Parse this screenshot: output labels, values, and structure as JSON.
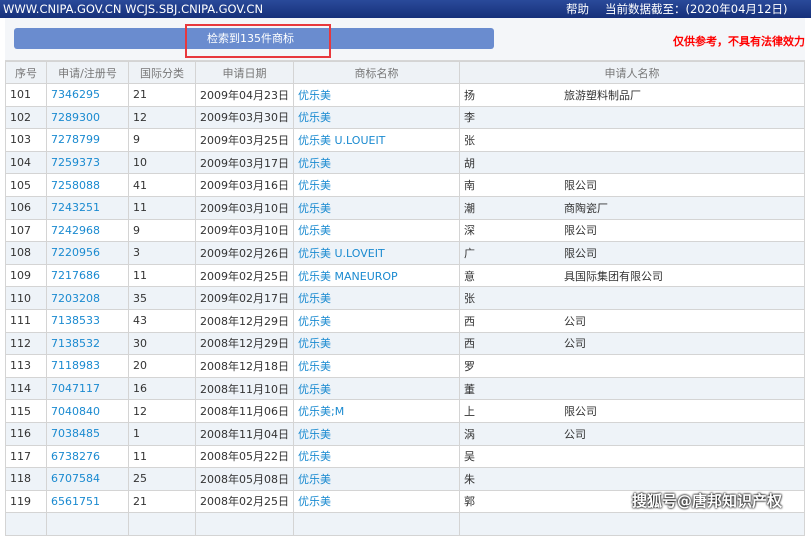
{
  "header": {
    "site": "WWW.CNIPA.GOV.CN WCJS.SBJ.CNIPA.GOV.CN",
    "help": "帮助",
    "data_date": "当前数据截至：(2020年04月12日)"
  },
  "search": {
    "result_label": "检索到135件商标",
    "disclaimer": "仅供参考，不具有法律效力"
  },
  "columns": [
    "序号",
    "申请/注册号",
    "国际分类",
    "申请日期",
    "商标名称",
    "申请人名称"
  ],
  "rows": [
    [
      "101",
      "7346295",
      "21",
      "2009年04月23日",
      "优乐美",
      "扬",
      "旅游塑料制品厂"
    ],
    [
      "102",
      "7289300",
      "12",
      "2009年03月30日",
      "优乐美",
      "李",
      ""
    ],
    [
      "103",
      "7278799",
      "9",
      "2009年03月25日",
      "优乐美 U.LOUEIT",
      "张",
      ""
    ],
    [
      "104",
      "7259373",
      "10",
      "2009年03月17日",
      "优乐美",
      "胡",
      ""
    ],
    [
      "105",
      "7258088",
      "41",
      "2009年03月16日",
      "优乐美",
      "南",
      "限公司"
    ],
    [
      "106",
      "7243251",
      "11",
      "2009年03月10日",
      "优乐美",
      "潮",
      "商陶瓷厂"
    ],
    [
      "107",
      "7242968",
      "9",
      "2009年03月10日",
      "优乐美",
      "深",
      "限公司"
    ],
    [
      "108",
      "7220956",
      "3",
      "2009年02月26日",
      "优乐美 U.LOVEIT",
      "广",
      "限公司"
    ],
    [
      "109",
      "7217686",
      "11",
      "2009年02月25日",
      "优乐美 MANEUROP",
      "意",
      "具国际集团有限公司"
    ],
    [
      "110",
      "7203208",
      "35",
      "2009年02月17日",
      "优乐美",
      "张",
      ""
    ],
    [
      "111",
      "7138533",
      "43",
      "2008年12月29日",
      "优乐美",
      "西",
      "公司"
    ],
    [
      "112",
      "7138532",
      "30",
      "2008年12月29日",
      "优乐美",
      "西",
      "公司"
    ],
    [
      "113",
      "7118983",
      "20",
      "2008年12月18日",
      "优乐美",
      "罗",
      ""
    ],
    [
      "114",
      "7047117",
      "16",
      "2008年11月10日",
      "优乐美",
      "董",
      ""
    ],
    [
      "115",
      "7040840",
      "12",
      "2008年11月06日",
      "优乐美;M",
      "上",
      "限公司"
    ],
    [
      "116",
      "7038485",
      "1",
      "2008年11月04日",
      "优乐美",
      "涡",
      "公司"
    ],
    [
      "117",
      "6738276",
      "11",
      "2008年05月22日",
      "优乐美",
      "吴",
      ""
    ],
    [
      "118",
      "6707584",
      "25",
      "2008年05月08日",
      "优乐美",
      "朱",
      ""
    ],
    [
      "119",
      "6561751",
      "21",
      "2008年02月25日",
      "优乐美",
      "郭",
      ""
    ],
    [
      "",
      "",
      "",
      "",
      "",
      "",
      ""
    ]
  ],
  "watermark": "搜狐号@唐邦知识产权"
}
